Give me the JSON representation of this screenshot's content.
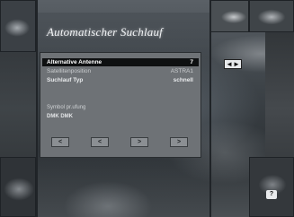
{
  "screen": {
    "title": "Automatischer Suchlauf"
  },
  "menu": {
    "rows": [
      {
        "label": "Alternative Antenne",
        "value": "7",
        "selected": true
      },
      {
        "label": "Satellitenposition",
        "value": "ASTRA1",
        "selected": false
      },
      {
        "label": "Suchlauf Typ",
        "value": "schnell",
        "selected": false
      }
    ],
    "section_label": "Symbol pr.ufung",
    "section_value": "DMK DMK",
    "buttons": [
      "<",
      "<",
      ">",
      ">"
    ]
  },
  "nav": {
    "arrow_icon": "left-right-arrow-icon",
    "arrow_glyph": "◄►"
  },
  "footer": {
    "help_icon": "help-icon",
    "help_glyph": "?"
  },
  "colors": {
    "menu_bg": "#6e7276",
    "selected_row": "#0e1011",
    "text": "#e8eaec"
  }
}
